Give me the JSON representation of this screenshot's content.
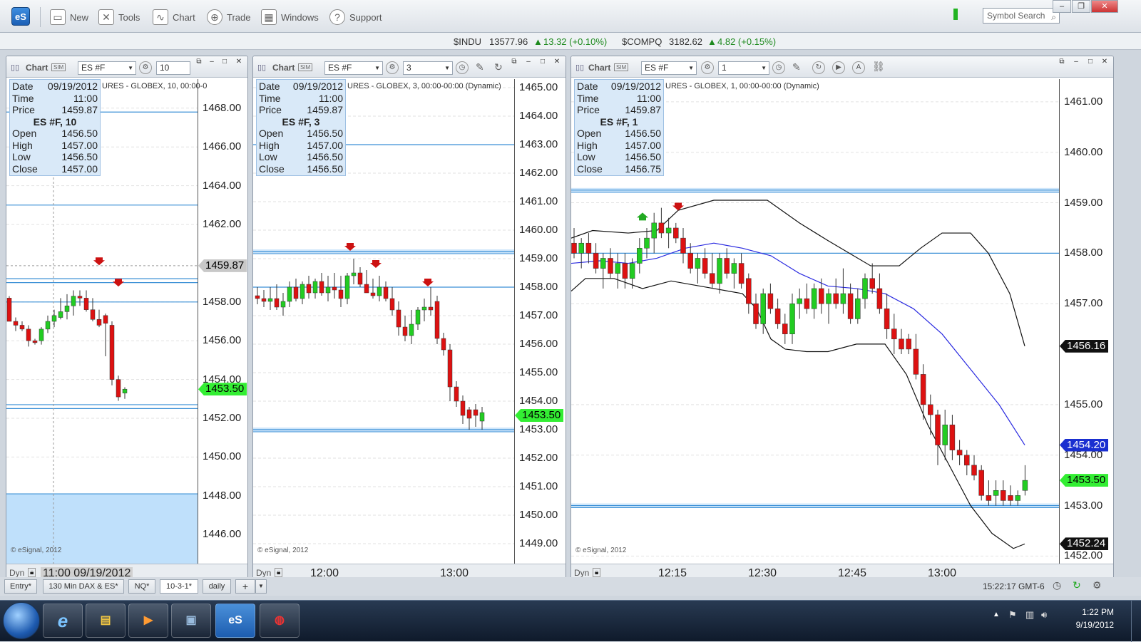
{
  "toolbar": {
    "new_label": "New",
    "tools_label": "Tools",
    "chart_label": "Chart",
    "trade_label": "Trade",
    "windows_label": "Windows",
    "support_label": "Support",
    "logo_text": "eS",
    "symbol_search_placeholder": "Symbol Search"
  },
  "ticker": {
    "indu_symbol": "$INDU",
    "indu_price": "13577.96",
    "indu_change": "13.32 (+0.10%)",
    "compq_symbol": "$COMPQ",
    "compq_price": "3182.62",
    "compq_change": "4.82 (+0.15%)"
  },
  "panels": [
    {
      "title": "Chart",
      "symbol": "ES #F",
      "interval": "10",
      "description": "URES - GLOBEX, 10, 00:00-0",
      "info": {
        "date_label": "Date",
        "date": "09/19/2012",
        "time_label": "Time",
        "time": "11:00",
        "price_label": "Price",
        "price": "1459.87",
        "header": "ES #F, 10",
        "open_label": "Open",
        "open": "1456.50",
        "high_label": "High",
        "high": "1457.00",
        "low_label": "Low",
        "low": "1456.50",
        "close_label": "Close",
        "close": "1457.00"
      },
      "price_ticks": [
        "1468.00",
        "1466.00",
        "1464.00",
        "1462.00",
        "1458.00",
        "1456.00",
        "1454.00",
        "1452.00",
        "1450.00",
        "1448.00",
        "1446.00"
      ],
      "last_price": "1453.50",
      "cursor_price": "1459.87",
      "footer_dyn": "Dyn",
      "footer_time": "11:00 09/19/2012",
      "copyright": "© eSignal, 2012"
    },
    {
      "title": "Chart",
      "symbol": "ES #F",
      "interval": "3",
      "description": "URES - GLOBEX, 3, 00:00-00:00 (Dynamic)",
      "info": {
        "date_label": "Date",
        "date": "09/19/2012",
        "time_label": "Time",
        "time": "11:00",
        "price_label": "Price",
        "price": "1459.87",
        "header": "ES #F, 3",
        "open_label": "Open",
        "open": "1456.50",
        "high_label": "High",
        "high": "1457.00",
        "low_label": "Low",
        "low": "1456.50",
        "close_label": "Close",
        "close": "1456.50"
      },
      "price_ticks": [
        "1465.00",
        "1464.00",
        "1463.00",
        "1462.00",
        "1461.00",
        "1460.00",
        "1459.00",
        "1458.00",
        "1457.00",
        "1456.00",
        "1455.00",
        "1454.00",
        "1453.00",
        "1452.00",
        "1451.00",
        "1450.00",
        "1449.00"
      ],
      "last_price": "1453.50",
      "footer_dyn": "Dyn",
      "time_ticks": [
        "12:00",
        "13:00"
      ],
      "copyright": "© eSignal, 2012"
    },
    {
      "title": "Chart",
      "symbol": "ES #F",
      "interval": "1",
      "description": "URES - GLOBEX, 1, 00:00-00:00 (Dynamic)",
      "info": {
        "date_label": "Date",
        "date": "09/19/2012",
        "time_label": "Time",
        "time": "11:00",
        "price_label": "Price",
        "price": "1459.87",
        "header": "ES #F, 1",
        "open_label": "Open",
        "open": "1456.50",
        "high_label": "High",
        "high": "1457.00",
        "low_label": "Low",
        "low": "1456.50",
        "close_label": "Close",
        "close": "1456.75"
      },
      "price_ticks": [
        "1461.00",
        "1460.00",
        "1459.00",
        "1458.00",
        "1457.00",
        "1455.00",
        "1454.00",
        "1453.00",
        "1452.00"
      ],
      "last_price": "1453.50",
      "upper_band_price": "1456.16",
      "ma_price": "1454.20",
      "lower_band_price": "1452.24",
      "footer_dyn": "Dyn",
      "time_ticks": [
        "12:15",
        "12:30",
        "12:45",
        "13:00"
      ],
      "copyright": "© eSignal, 2012"
    }
  ],
  "tabs": [
    "Entry*",
    "130 Min DAX & ES*",
    "NQ*",
    "10-3-1*",
    "daily"
  ],
  "tab_add": "+",
  "status": {
    "time": "15:22:17 GMT-6"
  },
  "taskbar": {
    "time": "1:22 PM",
    "date": "9/19/2012",
    "es_label": "eS"
  },
  "colors": {
    "up_candle": "#22cc22",
    "down_candle": "#dd1111",
    "level_line": "#3a8fd6",
    "ma_line": "#2a2ae0",
    "band_line": "#111111",
    "last_badge": "#33ee33",
    "ma_badge": "#1a2fd0"
  }
}
